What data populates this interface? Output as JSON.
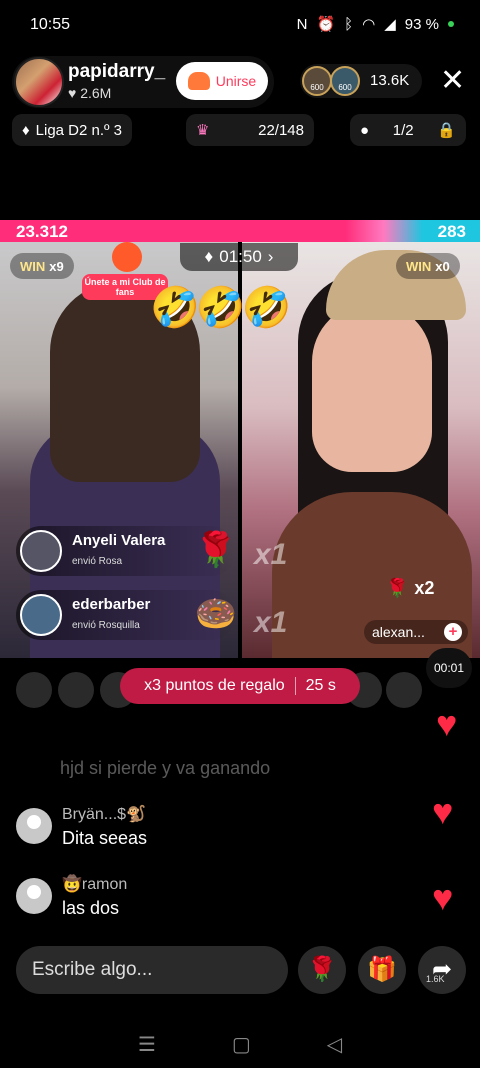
{
  "status_bar": {
    "time": "10:55",
    "battery": "93 %"
  },
  "host": {
    "name": "papidarry_",
    "likes": "2.6M",
    "join_label": "Unirse"
  },
  "viewers": {
    "count": "13.6K",
    "badge1": "600",
    "badge2": "600"
  },
  "league": {
    "label": "Liga D2 n.º 3",
    "rank": "22/148",
    "ratio": "1/2"
  },
  "battle": {
    "score_left": "23.312",
    "score_right": "283",
    "timer": "01:50",
    "win_left": "WIN",
    "win_left_count": "x9",
    "win_right": "WIN",
    "win_right_count": "x0",
    "club_text": "Únete a mi Club de fans",
    "emojis": "🤣🤣🤣"
  },
  "gifts": [
    {
      "name": "Anyeli Valera",
      "sent": "envió  Rosa",
      "icon": "🌹"
    },
    {
      "name": "ederbarber",
      "sent": "envió  Rosquilla",
      "icon": "🍩"
    }
  ],
  "right_gift": {
    "icon": "🌹",
    "count": "x2",
    "user": "alexan..."
  },
  "multipliers": {
    "a": "x1",
    "b": "x1"
  },
  "gift_points": {
    "label": "x3 puntos de regalo",
    "time": "25 s"
  },
  "small_timer": "00:01",
  "comments": [
    {
      "text": "hjd si pierde y va ganando"
    },
    {
      "name": "Bryän...$🐒",
      "text": "Dita seeas"
    },
    {
      "name": "🤠ramon",
      "text": "las dos"
    }
  ],
  "input": {
    "placeholder": "Escribe algo..."
  },
  "actions": {
    "share_count": "1.6K"
  },
  "colors": {
    "accent": "#ff2d7a",
    "opponent": "#1fc6e0",
    "heart": "#ff2a45"
  }
}
